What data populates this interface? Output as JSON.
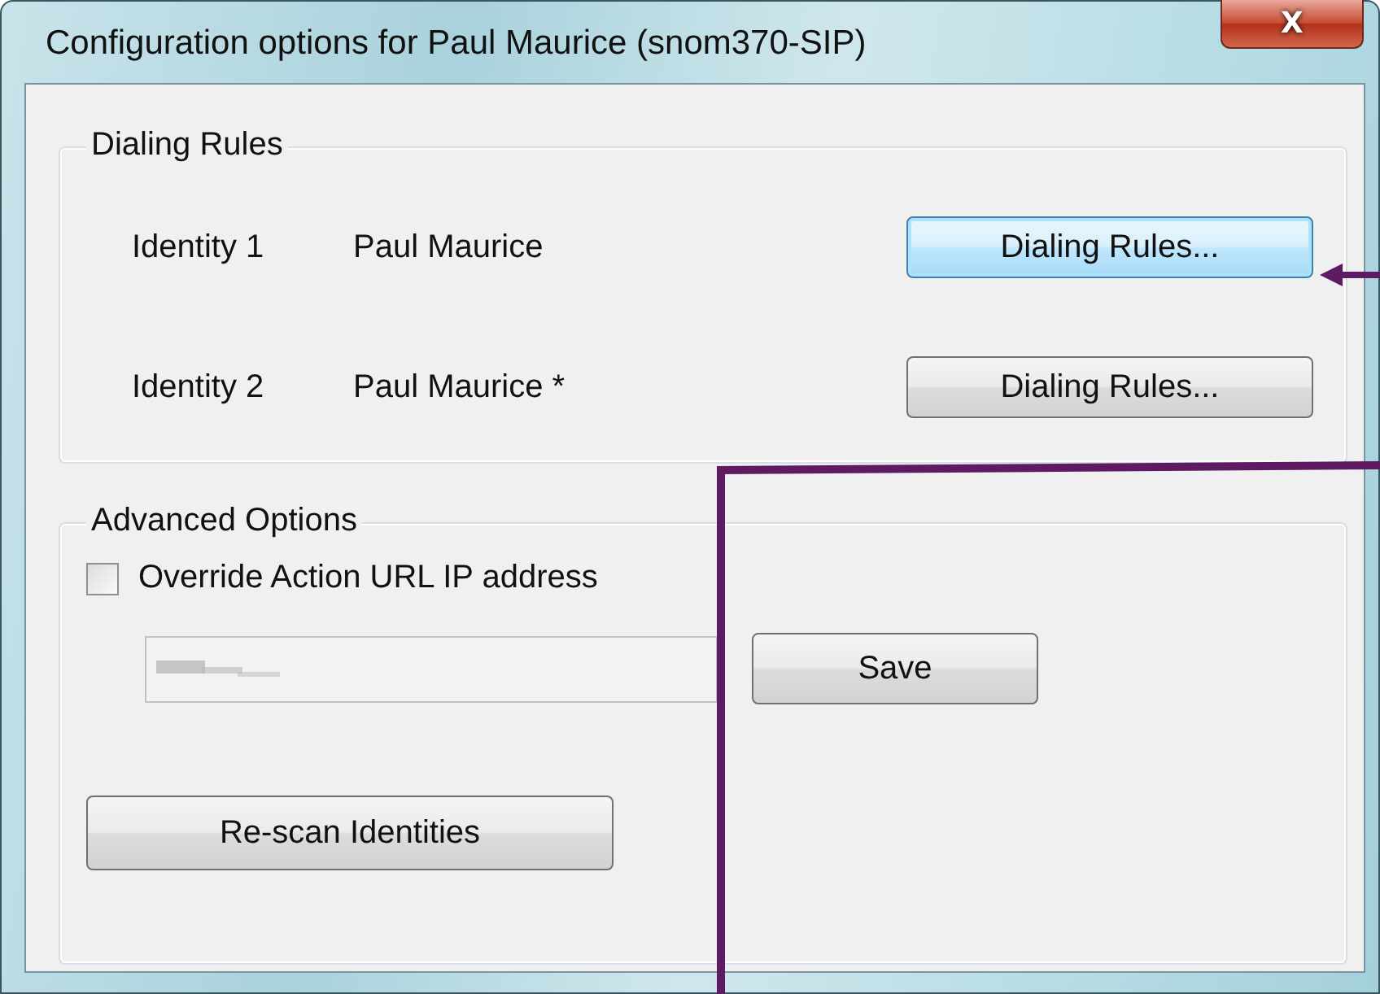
{
  "window": {
    "title": "Configuration options for Paul Maurice (snom370-SIP)",
    "close_button": "X"
  },
  "dialing_rules": {
    "title": "Dialing Rules",
    "identities": [
      {
        "label": "Identity 1",
        "name": "Paul Maurice",
        "button": "Dialing Rules...",
        "focused": true
      },
      {
        "label": "Identity 2",
        "name": "Paul Maurice *",
        "button": "Dialing Rules...",
        "focused": false
      }
    ]
  },
  "advanced_options": {
    "title": "Advanced Options",
    "override_checkbox": {
      "label": "Override Action URL IP address",
      "checked": false
    },
    "ip_field": {
      "disabled": true,
      "kind": "blurred"
    },
    "save_button": "Save",
    "rescan_button": "Re-scan Identities"
  },
  "annotations": {
    "arrow": true,
    "line": true
  }
}
